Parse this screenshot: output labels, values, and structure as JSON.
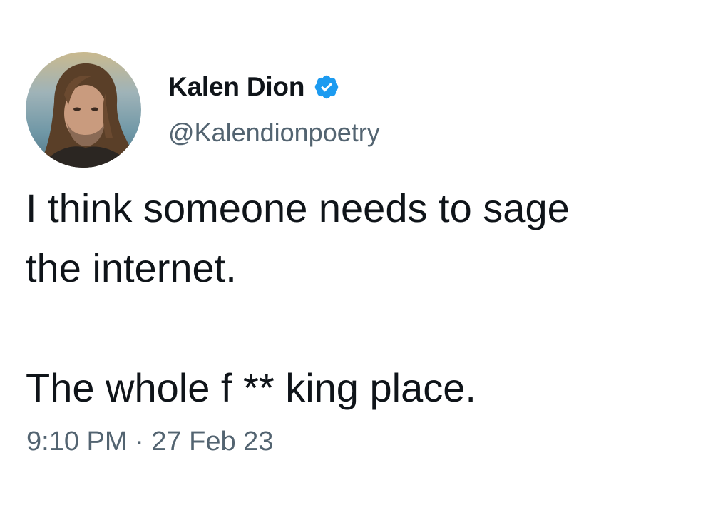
{
  "author": {
    "display_name": "Kalen Dion",
    "handle": "@Kalendionpoetry",
    "verified": true,
    "avatar_icon": "profile-photo"
  },
  "tweet": {
    "line1": "I think someone needs to sage",
    "line2": "the internet.",
    "line3": "The whole f ** king place."
  },
  "meta": {
    "time": "9:10 PM",
    "separator": " · ",
    "date": "27 Feb 23"
  },
  "colors": {
    "text_primary": "#0f1419",
    "text_secondary": "#536471",
    "verified_badge": "#1d9bf0",
    "background": "#ffffff"
  }
}
